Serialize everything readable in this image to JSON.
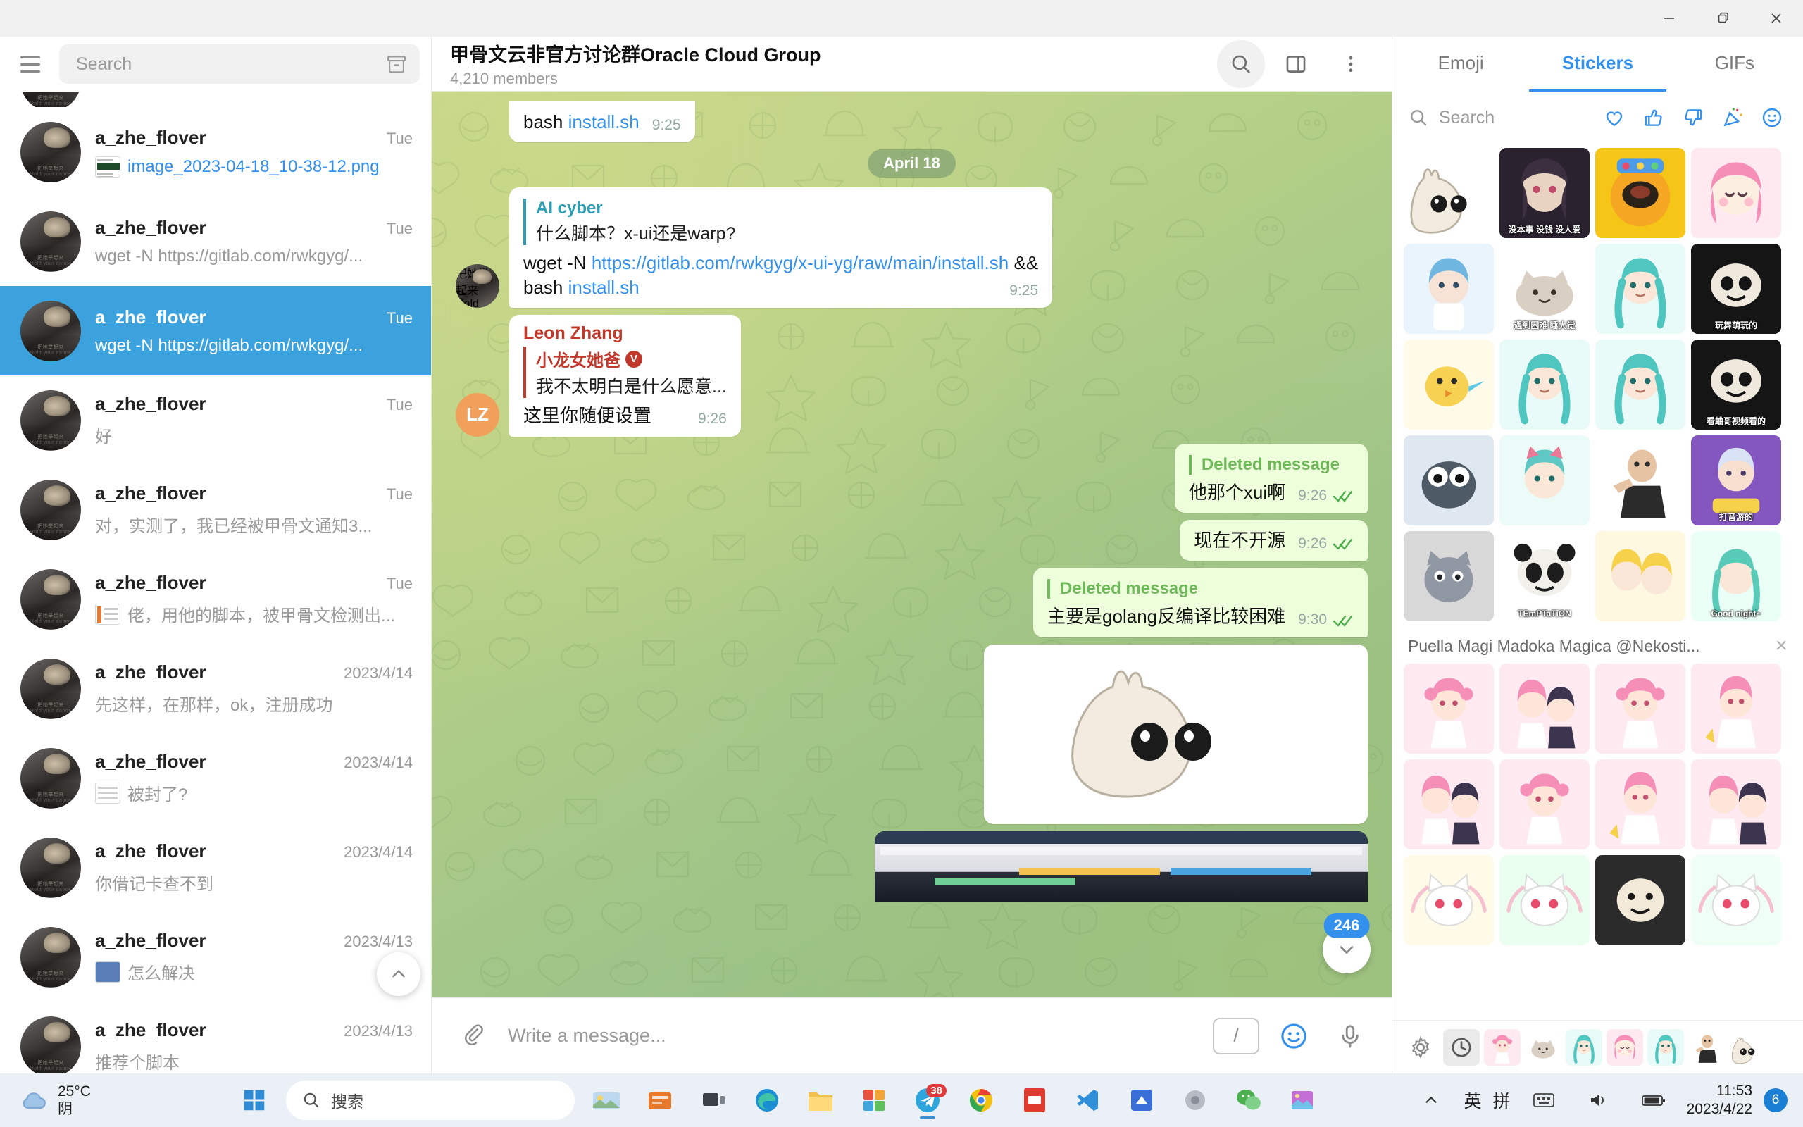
{
  "window": {
    "minimize_label": "Minimize",
    "maximize_label": "Restore",
    "close_label": "Close"
  },
  "sidebar": {
    "menu_label": "Menu",
    "search_placeholder": "Search",
    "archive_label": "Archived chats",
    "scroll_up_label": "Scroll to top",
    "chats": [
      {
        "name": "a_zhe_flover",
        "date": "Tue",
        "message": "image_2023-04-18_10-38-12.png",
        "message_is_link": true,
        "thumb": "green",
        "active": false
      },
      {
        "name": "a_zhe_flover",
        "date": "Tue",
        "message": "wget -N https://gitlab.com/rwkgyg/...",
        "message_is_link": false,
        "thumb": "",
        "active": false
      },
      {
        "name": "a_zhe_flover",
        "date": "Tue",
        "message": "wget -N https://gitlab.com/rwkgyg/...",
        "message_is_link": false,
        "thumb": "",
        "active": true
      },
      {
        "name": "a_zhe_flover",
        "date": "Tue",
        "message": "好",
        "message_is_link": false,
        "thumb": "",
        "active": false
      },
      {
        "name": "a_zhe_flover",
        "date": "Tue",
        "message": "对，实测了，我已经被甲骨文通知3...",
        "message_is_link": false,
        "thumb": "",
        "active": false
      },
      {
        "name": "a_zhe_flover",
        "date": "Tue",
        "message": "佬，用他的脚本，被甲骨文检测出...",
        "message_is_link": false,
        "thumb": "bar",
        "active": false
      },
      {
        "name": "a_zhe_flover",
        "date": "2023/4/14",
        "message": "先这样，在那样，ok，注册成功",
        "message_is_link": false,
        "thumb": "",
        "active": false
      },
      {
        "name": "a_zhe_flover",
        "date": "2023/4/14",
        "message": "被封了?",
        "message_is_link": false,
        "thumb": "doc",
        "active": false
      },
      {
        "name": "a_zhe_flover",
        "date": "2023/4/14",
        "message": "你借记卡查不到",
        "message_is_link": false,
        "thumb": "",
        "active": false
      },
      {
        "name": "a_zhe_flover",
        "date": "2023/4/13",
        "message": "怎么解决",
        "message_is_link": false,
        "thumb": "blue",
        "active": false
      },
      {
        "name": "a_zhe_flover",
        "date": "2023/4/13",
        "message": "推荐个脚本",
        "message_is_link": false,
        "thumb": "",
        "active": false
      }
    ]
  },
  "chat_header": {
    "title": "甲骨文云非官方讨论群Oracle Cloud Group",
    "subtitle": "4,210 members",
    "search_label": "Search messages",
    "panel_label": "Toggle info panel",
    "more_label": "More options"
  },
  "conversation": {
    "day_divider": "April 18",
    "messages": [
      {
        "id": "m1",
        "direction": "in",
        "partial": true,
        "text_prefix": "bash ",
        "text_link": "install.sh",
        "time": "9:25"
      },
      {
        "id": "m2",
        "direction": "in",
        "reply": {
          "name": "AI cyber",
          "text": "什么脚本？x-ui还是warp?",
          "color": "#2f9fb5"
        },
        "line1_prefix": "wget -N ",
        "line1_link": "https://gitlab.com/rwkgyg/x-ui-yg/raw/main/install.sh",
        "line1_suffix": " &&",
        "line2_prefix": "bash ",
        "line2_link": "install.sh",
        "time": "9:25"
      },
      {
        "id": "m3",
        "direction": "in",
        "sender": "Leon Zhang",
        "sender_color": "#c0392b",
        "avatar_initials": "LZ",
        "reply": {
          "name": "小龙女她爸",
          "verified": true,
          "text": "我不太明白是什么愿意...",
          "color": "#c0392b"
        },
        "text": "这里你随便设置",
        "time": "9:26"
      },
      {
        "id": "m4",
        "direction": "out",
        "reply": {
          "name": "Deleted message",
          "text": "",
          "color": "#6fb95a"
        },
        "text": "他那个xui啊",
        "time": "9:26",
        "status": "read"
      },
      {
        "id": "m5",
        "direction": "out",
        "text": "现在不开源",
        "time": "9:26",
        "status": "read"
      },
      {
        "id": "m6",
        "direction": "out",
        "reply": {
          "name": "Deleted message",
          "text": "",
          "color": "#6fb95a"
        },
        "text": "主要是golang反编译比较困难",
        "time": "9:30",
        "status": "read"
      },
      {
        "id": "m7",
        "direction": "out",
        "type": "sticker",
        "alt": "blob cat sticker"
      },
      {
        "id": "m8",
        "direction": "out",
        "type": "photo",
        "alt": "screenshot of desktop window"
      }
    ],
    "unread_count": "246",
    "scroll_down_label": "Scroll to bottom"
  },
  "composer": {
    "attach_label": "Attach file",
    "placeholder": "Write a message...",
    "command_label": "/",
    "emoji_label": "Emoji",
    "voice_label": "Record voice message"
  },
  "sticker_panel": {
    "tabs": [
      {
        "label": "Emoji",
        "active": false
      },
      {
        "label": "Stickers",
        "active": true
      },
      {
        "label": "GIFs",
        "active": false
      }
    ],
    "search_placeholder": "Search",
    "header_icons": [
      "heart-icon",
      "thumbs-up-icon",
      "thumbs-down-icon",
      "party-icon",
      "smile-icon"
    ],
    "set_name": "Puella Magi Madoka Magica @Nekosti...",
    "set_close_label": "×",
    "stickers": [
      [
        {
          "name": "blob-cat",
          "caption": "",
          "bg": "#ffffff",
          "kind": "blobcat"
        },
        {
          "name": "anime-dark",
          "caption": "没本事 没钱 没人爱",
          "bg": "#2a2330",
          "kind": "anime-dark"
        },
        {
          "name": "spinning-emoji",
          "caption": "",
          "bg": "#f5c518",
          "kind": "ball"
        },
        {
          "name": "pink-anime-girl",
          "caption": "",
          "bg": "#ffe6ef",
          "kind": "pinkgirl"
        }
      ],
      [
        {
          "name": "blue-hair-girl",
          "caption": "",
          "bg": "#e6f2fb",
          "kind": "bluegirl"
        },
        {
          "name": "cat-meme",
          "caption": "遇到困难 睡大觉",
          "bg": "#ffffff",
          "kind": "catmeme"
        },
        {
          "name": "miku-sticker",
          "caption": "",
          "bg": "#e8fbf8",
          "kind": "miku"
        },
        {
          "name": "face-meme",
          "caption": "玩舞萌玩的",
          "bg": "#111111",
          "kind": "facememe"
        }
      ],
      [
        {
          "name": "chick-sticker",
          "caption": "",
          "bg": "#fff8e0",
          "kind": "chick"
        },
        {
          "name": "miku-think",
          "caption": "",
          "bg": "#e8fbf8",
          "kind": "miku"
        },
        {
          "name": "miku-sweat",
          "caption": "",
          "bg": "#e8fbf8",
          "kind": "miku"
        },
        {
          "name": "face-meme-2",
          "caption": "看蛐哥视频看的",
          "bg": "#111111",
          "kind": "facememe"
        }
      ],
      [
        {
          "name": "googly-eyes",
          "caption": "",
          "bg": "#dfe8f0",
          "kind": "googly"
        },
        {
          "name": "cat-ears-girl",
          "caption": "",
          "bg": "#e8fbf8",
          "kind": "catgirl"
        },
        {
          "name": "pointing-man",
          "caption": "",
          "bg": "#ffffff",
          "kind": "pointing"
        },
        {
          "name": "game-sticker",
          "caption": "打音游的",
          "bg": "#7a4fb5",
          "kind": "gamegirl"
        }
      ],
      [
        {
          "name": "grey-cat",
          "caption": "",
          "bg": "#dcdcdc",
          "kind": "greycat"
        },
        {
          "name": "temptation-panda",
          "caption": "TEmPTaTiON",
          "bg": "#ffffff",
          "kind": "panda"
        },
        {
          "name": "blonde-twins",
          "caption": "",
          "bg": "#fff6d9",
          "kind": "blonde"
        },
        {
          "name": "good-night",
          "caption": "Good night~",
          "bg": "#eafff5",
          "kind": "goodnight"
        }
      ]
    ],
    "set_stickers": [
      [
        {
          "name": "madoka-1",
          "bg": "#ffeaf2",
          "kind": "madoka"
        },
        {
          "name": "madoka-2",
          "bg": "#ffeaf2",
          "kind": "madoka2"
        },
        {
          "name": "madoka-3",
          "bg": "#ffeaf2",
          "kind": "madoka"
        },
        {
          "name": "madoka-4",
          "bg": "#ffeaf2",
          "kind": "madoka3"
        }
      ],
      [
        {
          "name": "madoka-5",
          "bg": "#ffeaf2",
          "kind": "madoka2"
        },
        {
          "name": "madoka-6",
          "bg": "#ffeaf2",
          "kind": "madoka"
        },
        {
          "name": "madoka-7",
          "bg": "#ffeaf2",
          "kind": "madoka3"
        },
        {
          "name": "madoka-8",
          "bg": "#f3e6ff",
          "kind": "madoka2"
        }
      ],
      [
        {
          "name": "kyubey-1",
          "bg": "#fffbe8",
          "kind": "kyubey"
        },
        {
          "name": "kyubey-2",
          "bg": "#eafff0",
          "kind": "kyubey"
        },
        {
          "name": "charlotte",
          "bg": "#2b2b2b",
          "kind": "charlotte"
        },
        {
          "name": "kyubey-3",
          "bg": "#f0fff5",
          "kind": "kyubey"
        }
      ]
    ],
    "bottom_bar": [
      "settings-icon",
      "recent-icon",
      "set-1",
      "set-2",
      "set-3",
      "set-4",
      "set-5",
      "set-6",
      "set-7"
    ]
  },
  "taskbar": {
    "weather_temp": "25°C",
    "weather_cond": "阴",
    "start_label": "Start",
    "search_text": "搜索",
    "apps": [
      "task-view-icon",
      "edge-icon",
      "explorer-icon",
      "store-icon",
      "telegram-icon",
      "chrome-icon",
      "pdf-icon",
      "vscode-icon",
      "editor-icon",
      "app-icon",
      "wechat-icon",
      "picture-icon"
    ],
    "telegram_badge": "38",
    "ime_lang": "英",
    "ime_mode": "拼",
    "time": "11:53",
    "date": "2023/4/22",
    "notification_count": "6",
    "show_desktop_label": "Show desktop"
  }
}
